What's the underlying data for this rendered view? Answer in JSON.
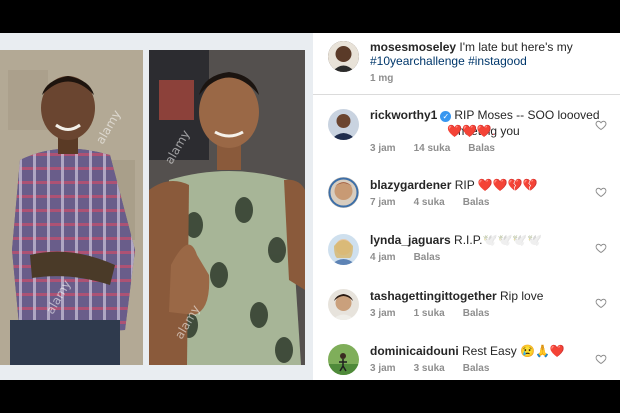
{
  "caption": {
    "username": "mosesmoseley",
    "text": "I'm late but here's my",
    "hashtags": "#10yearchallenge #instagood",
    "time": "1 mg"
  },
  "comments": [
    {
      "username": "rickworthy1",
      "verified": true,
      "text": "RIP Moses -- SOO loooved meeting you",
      "emoji": "❤️❤️❤️.",
      "time": "3 jam",
      "likes": "14 suka",
      "reply": "Balas"
    },
    {
      "username": "blazygardener",
      "verified": false,
      "text": "RIP",
      "emoji": "❤️❤️💔💔",
      "time": "7 jam",
      "likes": "4 suka",
      "reply": "Balas"
    },
    {
      "username": "lynda_jaguars",
      "verified": false,
      "text": "R.I.P.",
      "emoji": "🕊️🕊️🕊️🕊️",
      "time": "4 jam",
      "likes": "",
      "reply": "Balas"
    },
    {
      "username": "tashagettingittogether",
      "verified": false,
      "text": "Rip love",
      "emoji": "",
      "time": "3 jam",
      "likes": "1 suka",
      "reply": "Balas"
    },
    {
      "username": "dominicaidouni",
      "verified": false,
      "text": "Rest Easy",
      "emoji": "😢🙏❤️",
      "time": "3 jam",
      "likes": "3 suka",
      "reply": "Balas"
    }
  ],
  "watermarks": [
    "alamy",
    "alamy",
    "alamy",
    "alamy"
  ],
  "colors": {
    "heart": "#ed4956",
    "text": "#262626",
    "meta": "#8e8e8e",
    "hashtag": "#00376b",
    "verified": "#3897f0"
  }
}
